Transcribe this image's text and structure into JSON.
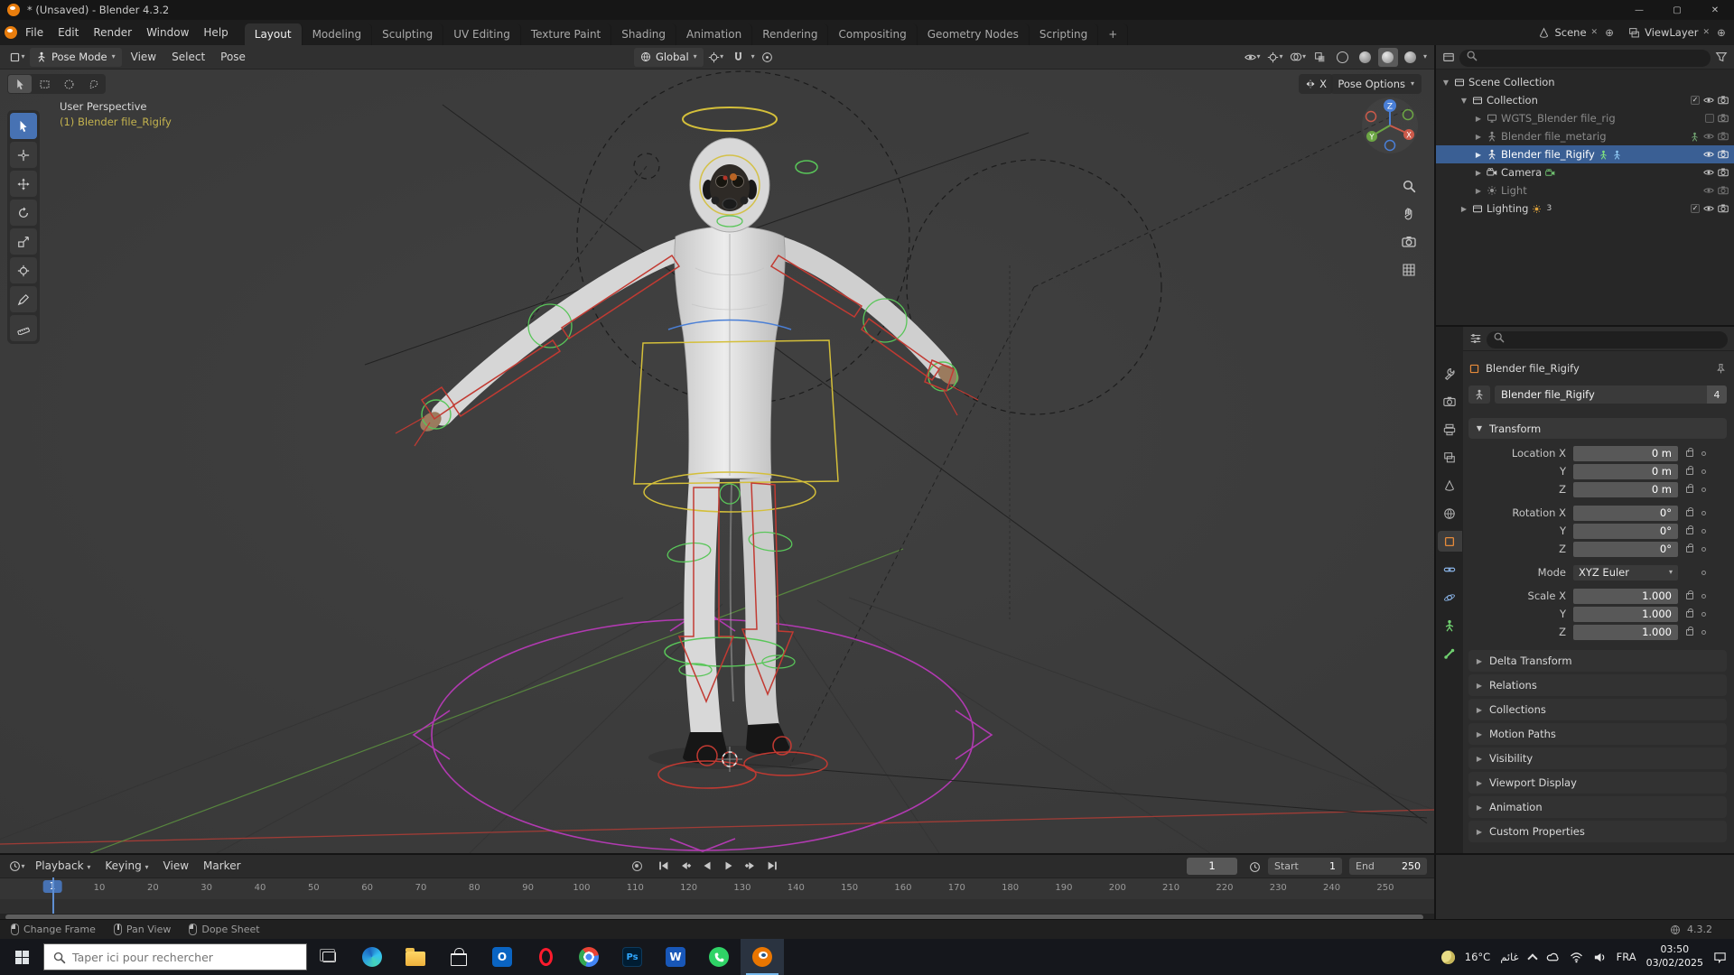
{
  "window": {
    "title": "* (Unsaved) - Blender 4.3.2"
  },
  "topbar": {
    "menus": [
      "File",
      "Edit",
      "Render",
      "Window",
      "Help"
    ],
    "workspaces": [
      "Layout",
      "Modeling",
      "Sculpting",
      "UV Editing",
      "Texture Paint",
      "Shading",
      "Animation",
      "Rendering",
      "Compositing",
      "Geometry Nodes",
      "Scripting"
    ],
    "add_workspace": "+",
    "scene_label": "Scene",
    "viewlayer_label": "ViewLayer"
  },
  "viewport": {
    "mode": "Pose Mode",
    "menus": [
      "View",
      "Select",
      "Pose"
    ],
    "orientation": "Global",
    "mirror_x": "X",
    "pose_options": "Pose Options",
    "view_label": "User Perspective",
    "object_label": "(1) Blender file_Rigify",
    "axes": {
      "x": "X",
      "y": "Y",
      "z": "Z"
    }
  },
  "outliner": {
    "rows": [
      {
        "label": "Scene Collection"
      },
      {
        "label": "Collection"
      },
      {
        "label": "WGTS_Blender file_rig"
      },
      {
        "label": "Blender file_metarig"
      },
      {
        "label": "Blender file_Rigify"
      },
      {
        "label": "Camera"
      },
      {
        "label": "Light"
      },
      {
        "label": "Lighting",
        "badge": "3"
      }
    ]
  },
  "properties": {
    "breadcrumb": "Blender file_Rigify",
    "object_name": "Blender file_Rigify",
    "users_count": "4",
    "panel_title": "Transform",
    "transform_rows": [
      {
        "label": "Location X",
        "value": "0 m"
      },
      {
        "label": "Y",
        "value": "0 m"
      },
      {
        "label": "Z",
        "value": "0 m"
      },
      {
        "label": "Rotation X",
        "value": "0°"
      },
      {
        "label": "Y",
        "value": "0°"
      },
      {
        "label": "Z",
        "value": "0°"
      },
      {
        "label": "Mode",
        "value": "XYZ Euler"
      },
      {
        "label": "Scale X",
        "value": "1.000"
      },
      {
        "label": "Y",
        "value": "1.000"
      },
      {
        "label": "Z",
        "value": "1.000"
      }
    ],
    "sections": [
      "Delta Transform",
      "Relations",
      "Collections",
      "Motion Paths",
      "Visibility",
      "Viewport Display",
      "Animation",
      "Custom Properties"
    ]
  },
  "timeline": {
    "menus": [
      "Playback",
      "Keying",
      "View",
      "Marker"
    ],
    "frame": "1",
    "start_label": "Start",
    "start_value": "1",
    "end_label": "End",
    "end_value": "250",
    "ticks": [
      10,
      20,
      30,
      40,
      50,
      60,
      70,
      80,
      90,
      100,
      110,
      120,
      130,
      140,
      150,
      160,
      170,
      180,
      190,
      200,
      210,
      220,
      230,
      240,
      250
    ]
  },
  "statusbar": {
    "hints": [
      "Change Frame",
      "Pan View",
      "Dope Sheet"
    ],
    "version": "4.3.2"
  },
  "taskbar": {
    "search_placeholder": "Taper ici pour rechercher",
    "apps": [
      "edge",
      "file-explorer",
      "store",
      "outlook",
      "opera",
      "chrome",
      "photoshop",
      "word",
      "whatsapp",
      "blender"
    ],
    "weather_temp": "16°C",
    "weather_desc": "غائم",
    "language": "FRA",
    "time": "03:50",
    "date": "03/02/2025"
  }
}
